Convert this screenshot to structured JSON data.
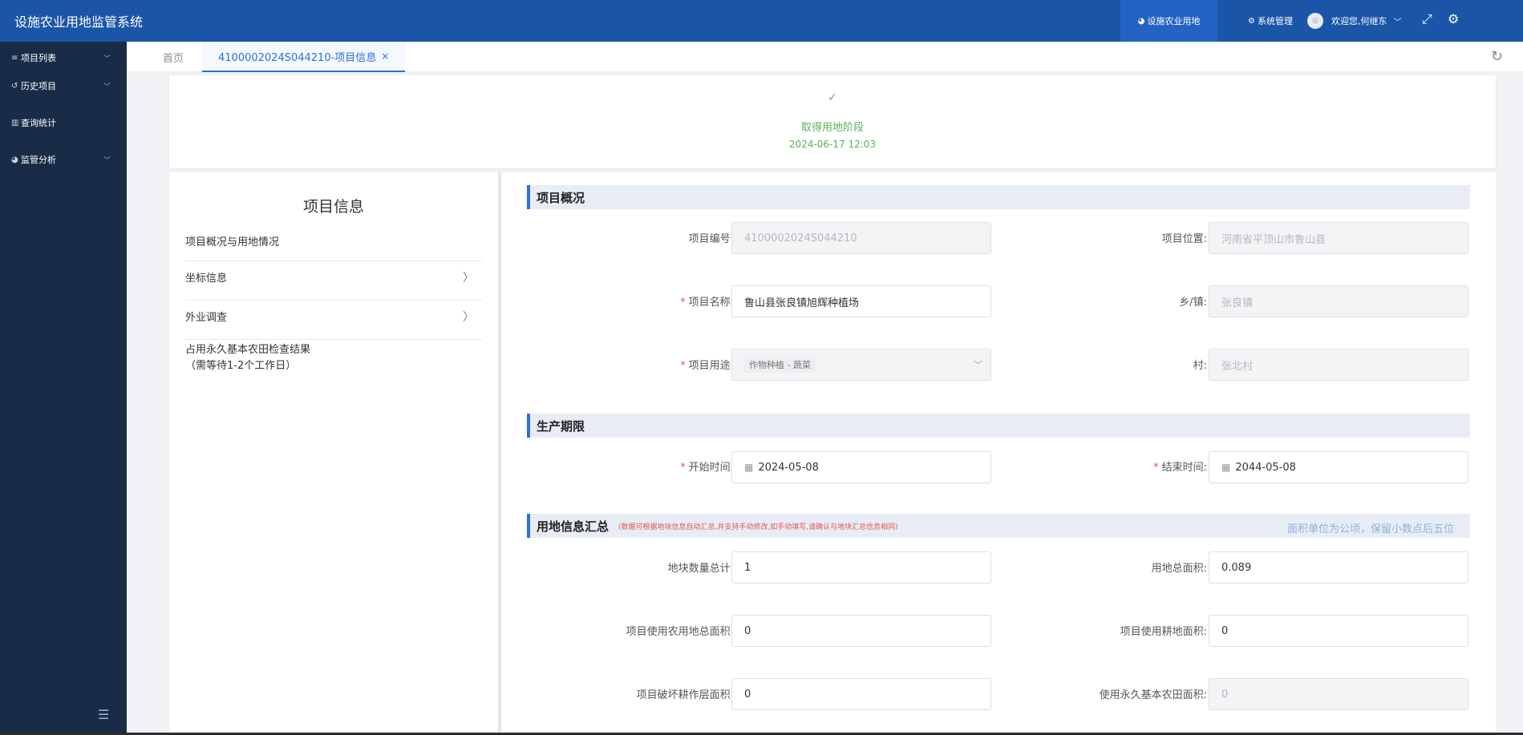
{
  "header": {
    "app_title": "设施农业用地监管系统",
    "menu_active": "设施农业用地",
    "menu_system": "系统管理",
    "welcome": "欢迎您,何继东",
    "avatar_text": "◎"
  },
  "sidebar": {
    "items": [
      {
        "label": "项目列表"
      },
      {
        "label": "历史项目"
      },
      {
        "label": "查询统计"
      },
      {
        "label": "监管分析"
      }
    ]
  },
  "tabs": {
    "home": "首页",
    "active": "4100002024S044210-项目信息",
    "close": "×"
  },
  "status": {
    "check": "✓",
    "stage": "取得用地阶段",
    "time": "2024-06-17 12:03",
    "color": "#59b15a"
  },
  "left_panel": {
    "title": "项目信息",
    "items": [
      {
        "label": "项目概况与用地情况"
      },
      {
        "label": "坐标信息"
      },
      {
        "label": "外业调查"
      },
      {
        "label": "占用永久基本农田检查结果"
      },
      {
        "label": "（需等待1-2个工作日）"
      }
    ]
  },
  "sections": {
    "overview": "项目概况",
    "period": "生产期限",
    "land": "用地信息汇总",
    "land_note": "(数据可根据地块信息自动汇总,并支持手动修改,如手动填写,请确认与地块汇总信息相同)",
    "land_unit": "面积单位为公顷，保留小数点后五位"
  },
  "fields": {
    "project_no_label": "项目编号:",
    "project_no": "4100002024S044210",
    "location_label": "项目位置:",
    "location": "河南省平顶山市鲁山县",
    "name_label": "项目名称:",
    "name": "鲁山县张良镇旭辉种植场",
    "town_label": "乡/镇:",
    "town": "张良镇",
    "use_label": "项目用途:",
    "use": "作物种植 - 蔬菜",
    "village_label": "村:",
    "village": "张北村",
    "start_label": "开始时间:",
    "start": "2024-05-08",
    "end_label": "结束时间:",
    "end": "2044-05-08",
    "plot_count_label": "地块数量总计:",
    "plot_count": "1",
    "total_area_label": "用地总面积:",
    "total_area": "0.089",
    "agri_area_label": "项目使用农用地总面积:",
    "agri_area": "0",
    "arable_area_label": "项目使用耕地面积:",
    "arable_area": "0",
    "damage_area_label": "项目破坏耕作层面积:",
    "damage_area": "0",
    "basic_farm_label": "使用永久基本农田面积:",
    "basic_farm": "0",
    "required_mark": "*"
  },
  "colors": {
    "header_bg": "#1a55a8",
    "sidebar_bg": "#192c47",
    "accent": "#2e6fd8",
    "required": "#e25555"
  }
}
